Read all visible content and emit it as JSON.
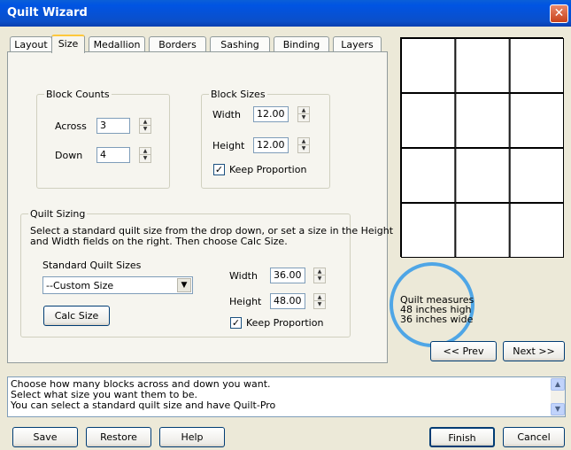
{
  "window": {
    "title": "Quilt Wizard",
    "close_icon": "close-icon"
  },
  "tabs": [
    "Layout",
    "Size",
    "Medallion",
    "Borders",
    "Sashing",
    "Binding",
    "Layers"
  ],
  "active_tab": "Size",
  "block_counts": {
    "legend": "Block Counts",
    "across_label": "Across",
    "across_value": "3",
    "down_label": "Down",
    "down_value": "4"
  },
  "block_sizes": {
    "legend": "Block Sizes",
    "width_label": "Width",
    "width_value": "12.00",
    "height_label": "Height",
    "height_value": "12.00",
    "keep_proportion_label": "Keep Proportion",
    "keep_proportion_checked": true
  },
  "quilt_sizing": {
    "legend": "Quilt Sizing",
    "instructions_line1": "Select a standard quilt size from the drop down, or set a size in the Height",
    "instructions_line2": "and Width fields on the right. Then choose Calc Size.",
    "standard_sizes_label": "Standard Quilt Sizes",
    "standard_sizes_value": "--Custom Size",
    "calc_size_label": "Calc Size",
    "width_label": "Width",
    "width_value": "36.00",
    "height_label": "Height",
    "height_value": "48.00",
    "keep_proportion_label": "Keep Proportion",
    "keep_proportion_checked": true
  },
  "preview": {
    "columns": 3,
    "rows": 4
  },
  "measures": {
    "line1": "Quilt measures",
    "line2": "48 inches high",
    "line3": "36 inches wide",
    "highlight_color": "#4fa6e6"
  },
  "nav": {
    "prev_label": "<< Prev",
    "next_label": "Next >>"
  },
  "status": {
    "line1": "Choose how many blocks across and down you want.",
    "line2": "Select what size you want them to be.",
    "line3": "You can select a standard quilt size and have Quilt-Pro"
  },
  "footer": {
    "save_label": "Save",
    "restore_label": "Restore",
    "help_label": "Help",
    "finish_label": "Finish",
    "cancel_label": "Cancel"
  }
}
